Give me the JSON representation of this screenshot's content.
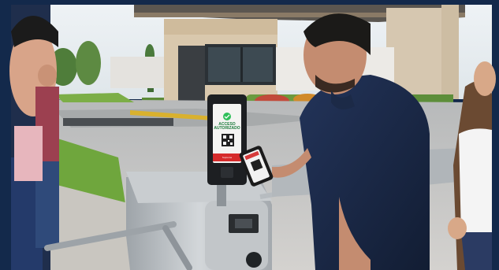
{
  "photo": {
    "subject": "visitor scanning phone QR code at access control turnstile",
    "colors": {
      "border": "#13294b",
      "sky": "#e9eef2",
      "building": "#d8c8b0",
      "grass": "#6fa63d",
      "shirt": "#1c2b48",
      "turnstile": "#b9bec3",
      "terminal": "#1d1f22",
      "screen_ok": "#2fbf5a"
    }
  },
  "terminal": {
    "status_line_1": "ACCESO",
    "status_line_2": "AUTORIZADO",
    "brand": "Suprema"
  }
}
